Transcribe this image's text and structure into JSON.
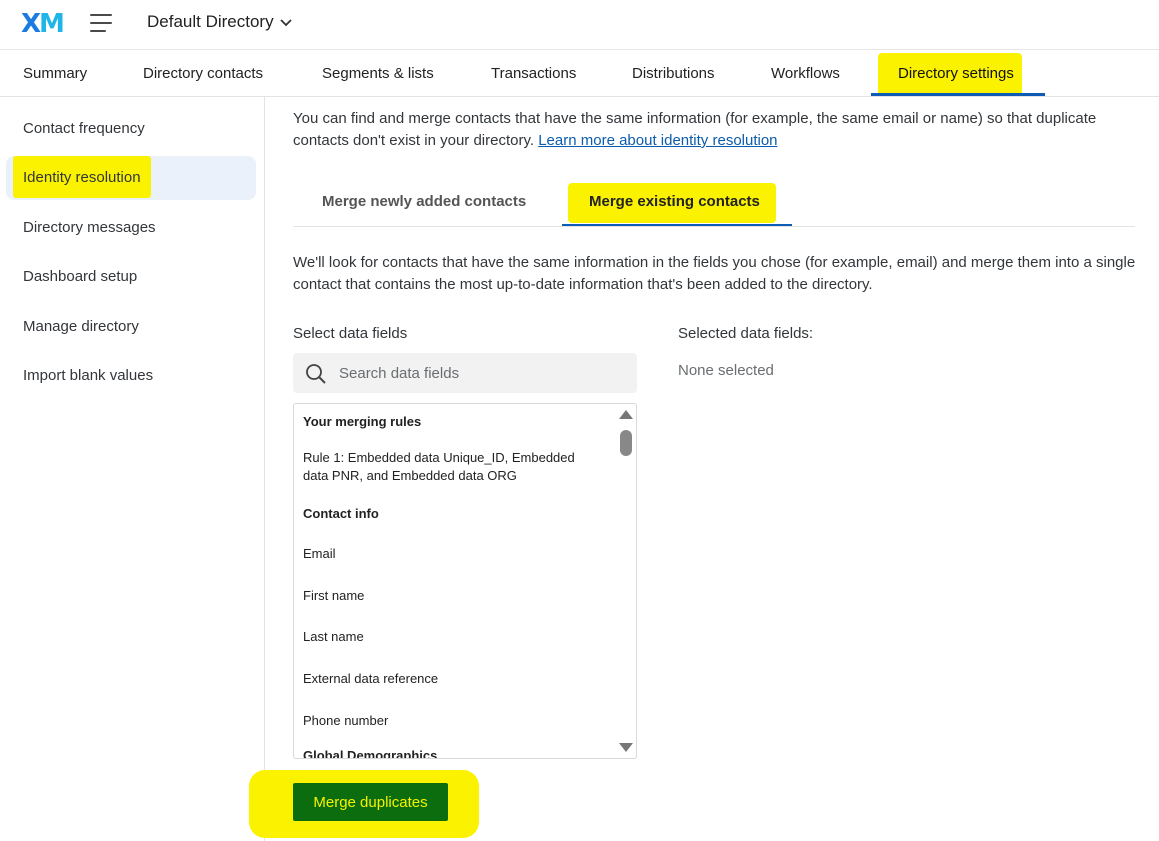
{
  "header": {
    "logo_x": "X",
    "logo_m": "M",
    "directory_name": "Default Directory"
  },
  "topnav": {
    "tabs": [
      {
        "label": "Summary"
      },
      {
        "label": "Directory contacts"
      },
      {
        "label": "Segments & lists"
      },
      {
        "label": "Transactions"
      },
      {
        "label": "Distributions"
      },
      {
        "label": "Workflows"
      },
      {
        "label": "Directory settings"
      }
    ],
    "active": "Directory settings"
  },
  "sidebar": {
    "items": [
      {
        "label": "Contact frequency"
      },
      {
        "label": "Identity resolution"
      },
      {
        "label": "Directory messages"
      },
      {
        "label": "Dashboard setup"
      },
      {
        "label": "Manage directory"
      },
      {
        "label": "Import blank values"
      }
    ],
    "active": "Identity resolution"
  },
  "main": {
    "intro_text": "You can find and merge contacts that have the same information (for example, the same email or name) so that duplicate contacts don't exist in your directory. ",
    "intro_link": "Learn more about identity resolution",
    "subtabs": [
      {
        "label": "Merge newly added contacts"
      },
      {
        "label": "Merge existing contacts"
      }
    ],
    "active_subtab": "Merge existing contacts",
    "description": "We'll look for contacts that have the same information in the fields you chose (for example, email) and merge them into a single contact that contains the most up-to-date information that's been added to the directory.",
    "select_label": "Select data fields",
    "selected_label": "Selected data fields:",
    "none_selected": "None selected",
    "search_placeholder": "Search data fields",
    "list": {
      "group_rules": "Your merging rules",
      "rule1": "Rule 1: Embedded data Unique_ID, Embedded data PNR, and Embedded data ORG",
      "group_contact": "Contact info",
      "fields": [
        "Email",
        "First name",
        "Last name",
        "External data reference",
        "Phone number"
      ],
      "group_demographics": "Global Demographics"
    },
    "merge_button": "Merge duplicates"
  },
  "colors": {
    "highlight": "#fbf200",
    "accent": "#0d5bb5",
    "button_bg": "#0c6d0f",
    "active_bg": "#ebf1fa"
  }
}
